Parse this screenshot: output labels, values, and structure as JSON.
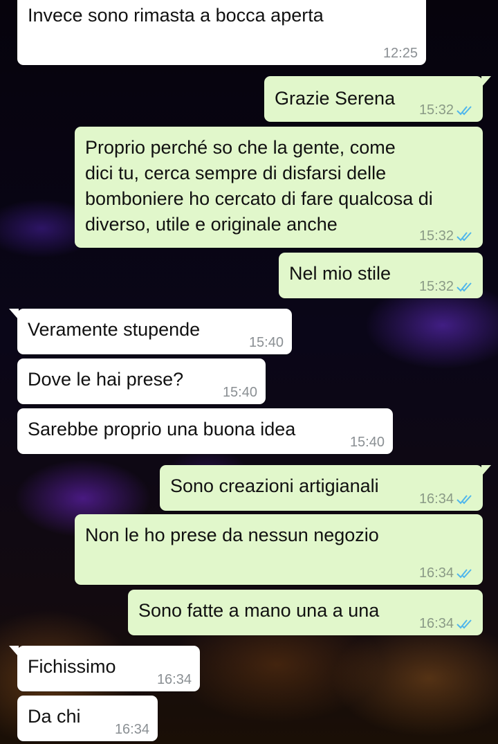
{
  "messages": [
    {
      "text": "Invece sono rimasta a bocca aperta",
      "time": "12:25",
      "direction": "in"
    },
    {
      "text": "Grazie Serena",
      "time": "15:32",
      "direction": "out",
      "status": "read"
    },
    {
      "text": "Proprio perché so che la gente, come\ndici tu, cerca sempre di disfarsi delle\nbomboniere ho cercato di fare qualcosa di\ndiverso, utile e originale anche",
      "time": "15:32",
      "direction": "out",
      "status": "read"
    },
    {
      "text": "Nel mio stile",
      "time": "15:32",
      "direction": "out",
      "status": "read"
    },
    {
      "text": "Veramente stupende",
      "time": "15:40",
      "direction": "in"
    },
    {
      "text": "Dove le hai prese?",
      "time": "15:40",
      "direction": "in"
    },
    {
      "text": "Sarebbe proprio una buona idea",
      "time": "15:40",
      "direction": "in"
    },
    {
      "text": "Sono creazioni artigianali",
      "time": "16:34",
      "direction": "out",
      "status": "read"
    },
    {
      "text": "Non le ho prese da nessun negozio",
      "time": "16:34",
      "direction": "out",
      "status": "read"
    },
    {
      "text": "Sono fatte a mano una a una",
      "time": "16:34",
      "direction": "out",
      "status": "read"
    },
    {
      "text": "Fichissimo",
      "time": "16:34",
      "direction": "in"
    },
    {
      "text": "Da chi",
      "time": "16:34",
      "direction": "in"
    }
  ],
  "colors": {
    "incoming": "#ffffff",
    "outgoing": "#e1f7cb",
    "read_ticks": "#4fb6ec"
  }
}
